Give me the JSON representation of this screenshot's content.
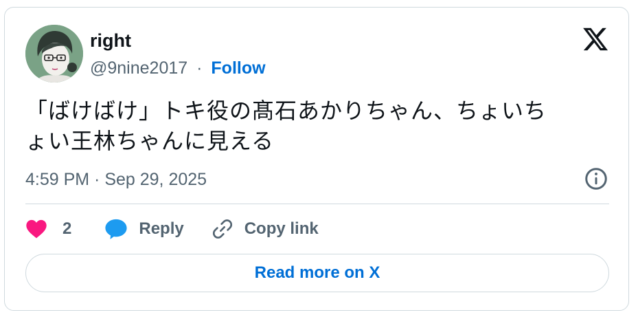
{
  "author": {
    "display_name": "right",
    "handle": "@9nine2017",
    "separator": "·",
    "follow_label": "Follow"
  },
  "tweet": {
    "text_line1": "「ばけばけ」トキ役の髙石あかりちゃん、ちょいち",
    "text_line2": "ょい王林ちゃんに見える",
    "timestamp": "4:59 PM · Sep 29, 2025"
  },
  "actions": {
    "like_count": "2",
    "reply_label": "Reply",
    "copy_link_label": "Copy link"
  },
  "footer": {
    "read_more_label": "Read more on X"
  },
  "icons": {
    "avatar": "avatar-illustration",
    "logo": "x-logo-icon",
    "info": "info-icon",
    "like": "heart-icon",
    "reply": "speech-bubble-icon",
    "copy": "link-icon"
  },
  "colors": {
    "like": "#f91880",
    "reply": "#1d9bf0",
    "link": "#006fd6",
    "muted": "#536471",
    "border": "#cfd9de",
    "avatar_bg": "#7aa286"
  }
}
